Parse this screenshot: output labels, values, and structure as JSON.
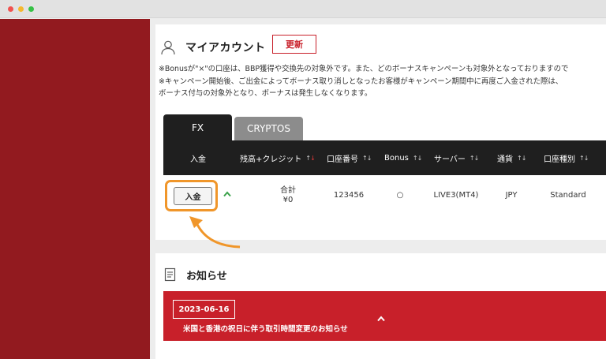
{
  "window": {
    "controls": [
      "close",
      "minimize",
      "maximize"
    ]
  },
  "colors": {
    "sidebar": "#921a1f",
    "accent": "#c8202a",
    "highlight": "#f0962a",
    "table_header": "#1f1f1f"
  },
  "account": {
    "icon": "user-icon",
    "title": "マイアカウント",
    "refresh_label": "更新",
    "notes": [
      "※Bonusが\"×\"の口座は、BBP獲得や交換先の対象外です。また、どのボーナスキャンペーンも対象外となっておりますので",
      "※キャンペーン開始後、ご出金によってボーナス取り消しとなったお客様がキャンペーン期間中に再度ご入金された際は、",
      "ボーナス付与の対象外となり、ボーナスは発生しなくなります。"
    ],
    "tabs": [
      {
        "label": "FX",
        "active": true
      },
      {
        "label": "CRYPTOS",
        "active": false
      }
    ],
    "columns": [
      "入金",
      "残高+クレジット",
      "口座番号",
      "Bonus",
      "サーバー",
      "通貨",
      "口座種別"
    ],
    "row": {
      "deposit_label": "入金",
      "balance_label": "合計",
      "balance_value": "¥0",
      "account_number": "123456",
      "bonus": "○",
      "server": "LIVE3(MT4)",
      "currency": "JPY",
      "account_type": "Standard"
    }
  },
  "news": {
    "icon": "notice-icon",
    "title": "お知らせ",
    "items": [
      {
        "date": "2023-06-16",
        "text": "米国と香港の祝日に伴う取引時間変更のお知らせ"
      }
    ]
  }
}
